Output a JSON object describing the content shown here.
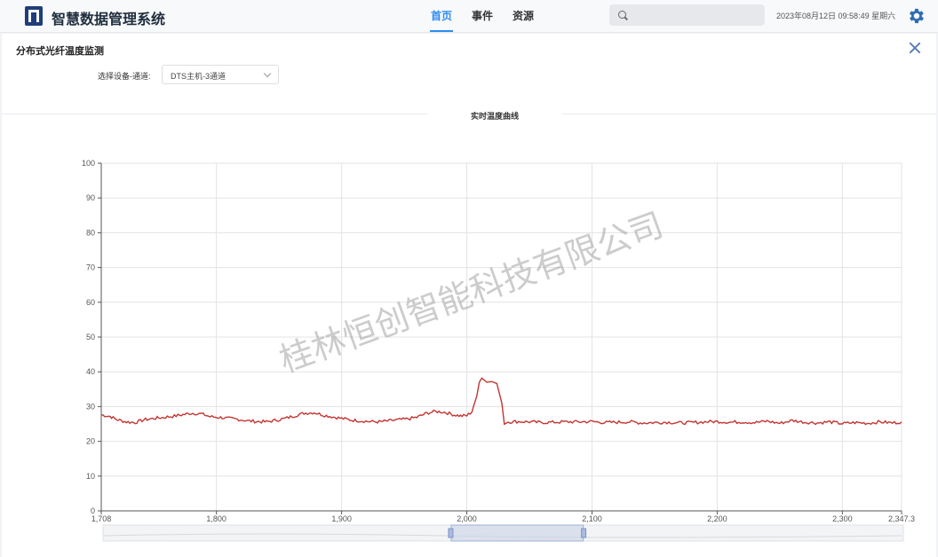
{
  "app": {
    "title": "智慧数据管理系统"
  },
  "nav": [
    {
      "label": "首页",
      "active": true
    },
    {
      "label": "事件",
      "active": false
    },
    {
      "label": "资源",
      "active": false
    }
  ],
  "search": {
    "placeholder": ""
  },
  "datetime": "2023年08月12日 09:58:49 星期六",
  "panel": {
    "title": "分布式光纤温度监测",
    "selector_label": "选择设备-通道:",
    "selector_value": "DTS主机-3通道",
    "chart_title": "实时温度曲线"
  },
  "watermark": "桂林恒创智能科技有限公司",
  "colors": {
    "accent": "#2d8cf0",
    "line": "#c23531",
    "gear": "#2e6db4"
  },
  "chart_data": {
    "type": "line",
    "title": "实时温度曲线",
    "xlim": [
      1708,
      2347.3
    ],
    "ylim": [
      0,
      100
    ],
    "x_ticks": [
      "1,708",
      "1,800",
      "1,900",
      "2,000",
      "2,100",
      "2,200",
      "2,300",
      "2,347.3"
    ],
    "y_ticks": [
      "0",
      "10",
      "20",
      "30",
      "40",
      "50",
      "60",
      "70",
      "80",
      "90",
      "100"
    ],
    "grid": true,
    "series": [
      {
        "x": [
          1708,
          1715,
          1720,
          1728,
          1735,
          1742,
          1750,
          1758,
          1765,
          1772,
          1780,
          1788,
          1795,
          1802,
          1810,
          1818,
          1825,
          1832,
          1840,
          1848,
          1855,
          1862,
          1870,
          1878,
          1885,
          1892,
          1900,
          1908,
          1915,
          1922,
          1930,
          1938,
          1945,
          1952,
          1960,
          1968,
          1975,
          1982,
          1990,
          1995,
          2000,
          2004,
          2008,
          2010,
          2012,
          2016,
          2020,
          2024,
          2028,
          2030,
          2032,
          2036,
          2040,
          2050,
          2060,
          2070,
          2080,
          2090,
          2100,
          2110,
          2120,
          2130,
          2140,
          2150,
          2160,
          2170,
          2180,
          2190,
          2200,
          2210,
          2220,
          2230,
          2240,
          2250,
          2260,
          2270,
          2280,
          2290,
          2300,
          2310,
          2320,
          2330,
          2340,
          2347.3
        ],
        "y": [
          27.6,
          27.2,
          26.3,
          25.6,
          25.4,
          26.2,
          26.6,
          26.9,
          27.2,
          27.6,
          28.1,
          27.9,
          27.1,
          26.9,
          26.6,
          26.3,
          25.9,
          25.7,
          25.6,
          26.1,
          26.6,
          27.3,
          28.1,
          28.3,
          27.6,
          27.1,
          26.6,
          26.1,
          25.9,
          25.7,
          25.6,
          25.9,
          26.2,
          26.4,
          26.9,
          28.1,
          28.6,
          28.4,
          27.6,
          27.3,
          27.4,
          28.5,
          33.0,
          37.0,
          38.2,
          37.0,
          37.2,
          36.6,
          31.0,
          25.0,
          25.6,
          25.6,
          25.7,
          25.6,
          25.4,
          25.5,
          25.6,
          25.6,
          25.7,
          25.4,
          25.5,
          25.6,
          25.3,
          25.4,
          25.5,
          25.3,
          25.4,
          25.6,
          25.7,
          25.5,
          25.6,
          25.4,
          25.8,
          25.2,
          26.0,
          25.5,
          25.3,
          25.6,
          25.1,
          25.4,
          25.2,
          25.6,
          25.3,
          25.6
        ]
      }
    ],
    "zoom": {
      "start": 0.435,
      "end": 0.6
    }
  }
}
